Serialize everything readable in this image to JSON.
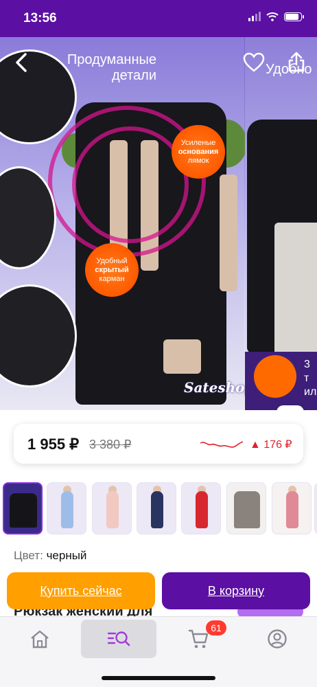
{
  "status_bar": {
    "time": "13:56",
    "icons": [
      "signal-icon",
      "wifi-icon",
      "battery-icon"
    ],
    "battery_level_percent": 85
  },
  "gallery": {
    "slide_caption": "Продуманные\nдетали",
    "next_slide_caption": "Удобно",
    "badge_straps": {
      "line1": "Усиленые",
      "line2": "основания",
      "line3": "лямок"
    },
    "badge_pocket": {
      "line1": "Удобный",
      "line2": "скрытый",
      "line3": "карман"
    },
    "brand_logo": "Sateshop",
    "next_banner_text": "3 т\nил",
    "icons": [
      "back-arrow-icon",
      "heart-icon",
      "share-icon",
      "image-search-icon"
    ]
  },
  "price": {
    "current": "1 955 ₽",
    "old": "3 380 ₽",
    "delta": "▲ 176 ₽",
    "trend_color": "#e0222a"
  },
  "thumbnails": {
    "count": 8,
    "active_index": 0
  },
  "color_selector": {
    "label": "Цвет:",
    "value": "черный"
  },
  "buttons": {
    "buy_now": "Купить сейчас",
    "add_to_cart": "В корзину"
  },
  "product": {
    "title_peek": "Рюкзак женский для"
  },
  "tabbar": {
    "items": [
      {
        "name": "home",
        "icon": "home-icon"
      },
      {
        "name": "catalog",
        "icon": "catalog-search-icon",
        "active": true
      },
      {
        "name": "cart",
        "icon": "cart-icon"
      },
      {
        "name": "profile",
        "icon": "profile-icon"
      }
    ],
    "cart_count": "61"
  },
  "colors": {
    "brand_purple": "#5b0fa3",
    "buy_orange": "#ff9f00",
    "accent_red": "#e0222a"
  }
}
